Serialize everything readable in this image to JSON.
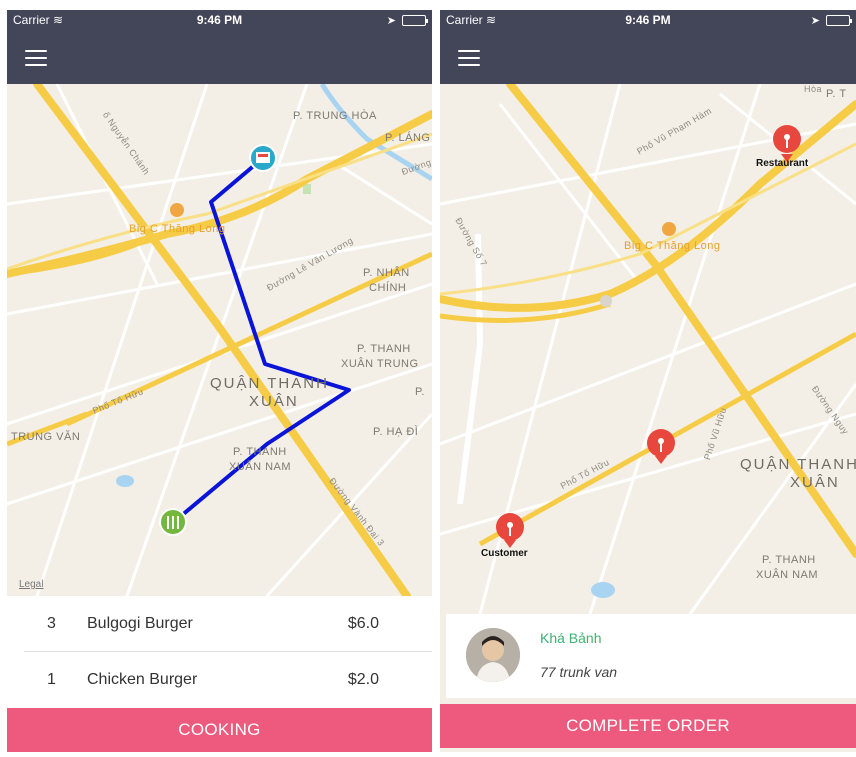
{
  "status_bar": {
    "carrier": "Carrier",
    "time": "9:46 PM"
  },
  "left_screen": {
    "map_labels": {
      "p_trung_hoa": "P. TRUNG HÒA",
      "p_lang": "P. LÁNG",
      "duong": "Đường",
      "nguyen_chanh": "ố Nguyễn Chánh",
      "big_c": "Big C Thăng Long",
      "le_van_luong": "Đường Lê Văn Lương",
      "p_nhan_chinh": "P. NHÂN",
      "p_nhan_chinh_2": "CHÍNH",
      "p_thanh_xuan_trung": "P. THANH",
      "p_thanh_xuan_trung_2": "XUÂN TRUNG",
      "quan_thanh_xuan": "QUẬN THANH",
      "quan_thanh_xuan_2": "XUÂN",
      "pho_to_huu": "Phố Tố Hữu",
      "trung_van": "TRUNG VĂN",
      "p_thanh_xuan_nam": "P. THANH",
      "p_thanh_xuan_nam_2": "XUÂN NAM",
      "p_ha_dinh": "P. HẠ ĐÌ",
      "p": "P.",
      "vanh_dai_3": "Đường Vành Đai 3",
      "legal": "Legal"
    },
    "order_items": [
      {
        "qty": "3",
        "name": "Bulgogi Burger",
        "price": "$6.0"
      },
      {
        "qty": "1",
        "name": "Chicken Burger",
        "price": "$2.0"
      }
    ],
    "action_label": "COOKING"
  },
  "right_screen": {
    "map_labels": {
      "p_tr": "P. T",
      "hoa": "Hòa",
      "pho_vu_pham_ham": "Phố Vũ Phạm Hàm",
      "duong_so_7": "Đường Số 7",
      "big_c": "Big C Thăng Long",
      "pho_to_huu": "Phố Tố Hữu",
      "pho_vu_huu": "Phố Vũ Hữu",
      "quan_thanh": "QUẬN THANH",
      "xuan": "XUÂN",
      "p_thanh": "P. THANH",
      "xuan_nam": "XUÂN NAM",
      "duong_nguy": "Đường Nguy",
      "restaurant": "Restaurant",
      "customer": "Customer"
    },
    "customer": {
      "name": "Khá Bảnh",
      "address": "77 trunk van"
    },
    "action_label": "COMPLETE ORDER"
  },
  "colors": {
    "header": "#434558",
    "accent_button": "#ed5a7e",
    "route": "#0a14d9",
    "customer_name": "#3cb371",
    "pin": "#e8473d"
  }
}
